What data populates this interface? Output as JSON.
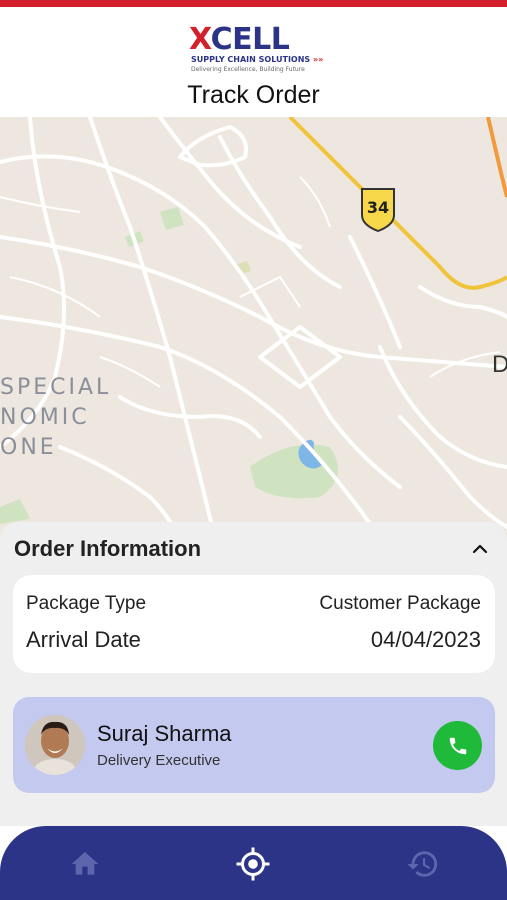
{
  "app": {
    "brand_name_x": "X",
    "brand_name_rest": "CELL",
    "brand_subtitle": "SUPPLY CHAIN SOLUTIONS",
    "brand_arrows": "»»",
    "brand_tagline": "Delivering Excellence, Building Future",
    "page_title": "Track Order"
  },
  "map": {
    "labels": [
      "SPECIAL",
      "NOMIC",
      "ONE"
    ],
    "highway_shield": "34",
    "edge_letter": "D"
  },
  "order": {
    "section_title": "Order Information",
    "rows": [
      {
        "label": "Package Type",
        "value": "Customer Package"
      },
      {
        "label": "Arrival Date",
        "value": "04/04/2023"
      }
    ]
  },
  "executive": {
    "name": "Suraj Sharma",
    "role": "Delivery Executive"
  },
  "nav": {
    "items": [
      {
        "name": "home",
        "icon": "home-icon",
        "active": false
      },
      {
        "name": "track",
        "icon": "locate-icon",
        "active": true
      },
      {
        "name": "history",
        "icon": "history-icon",
        "active": false
      }
    ]
  },
  "colors": {
    "brand_red": "#d3202a",
    "brand_navy": "#2b3487",
    "exec_card_bg": "#c3c9ef",
    "call_green": "#1fba39",
    "highway_yellow": "#f0c43a"
  }
}
